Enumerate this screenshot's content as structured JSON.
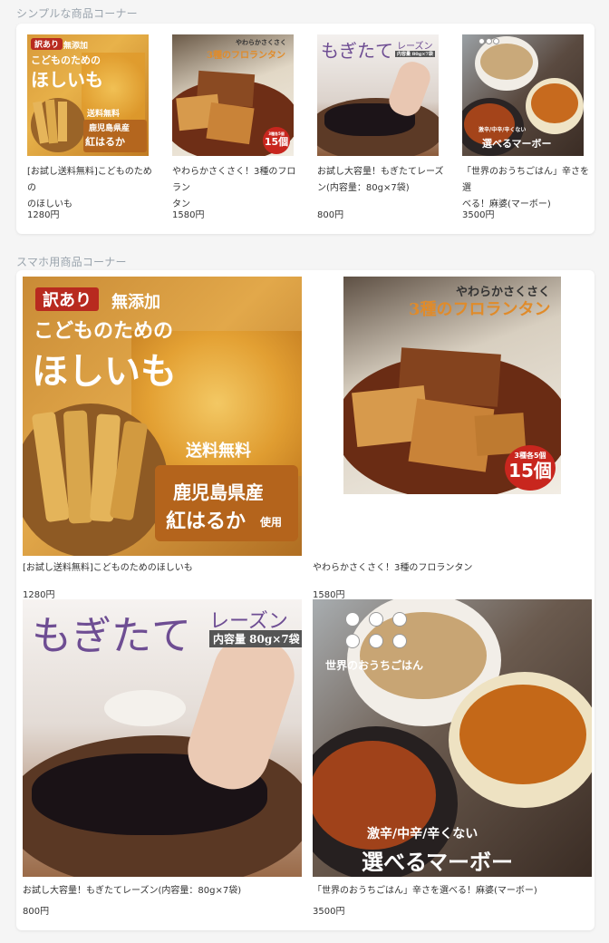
{
  "simple_section": {
    "title": "シンプルな商品コーナー",
    "items": [
      {
        "name": "[お試し送料無料]こどものための",
        "name2": "のほしいも",
        "price": "1280円"
      },
      {
        "name": "やわらかさくさく！3種のフロラン",
        "name2": "タン",
        "price": "1580円"
      },
      {
        "name": "お試し大容量！もぎたてレーズ",
        "name2": "ン(内容量：80g×7袋)",
        "price": "800円"
      },
      {
        "name": "「世界のおうちごはん」辛さを選",
        "name2": "べる！麻婆(マーボー)",
        "price": "3500円"
      }
    ]
  },
  "mobile_section": {
    "title": "スマホ用商品コーナー",
    "items": [
      {
        "name": "[お試し送料無料]こどものためのほしいも",
        "price": "1280円"
      },
      {
        "name": "やわらかさくさく！3種のフロランタン",
        "price": "1580円"
      },
      {
        "name": "お試し大容量！もぎたてレーズン(内容量：80g×7袋)",
        "price": "800円"
      },
      {
        "name": "「世界のおうちごはん」辛さを選べる！麻婆(マーボー)",
        "price": "3500円"
      }
    ]
  },
  "images": {
    "hoshiimo": {
      "badge": "訳あり",
      "line1": "無添加",
      "line2": "こどものための",
      "line3": "ほしいも",
      "line4": "送料無料",
      "line5": "鹿児島県産",
      "line6": "紅はるか",
      "line6b": "使用"
    },
    "florentin": {
      "line1": "やわらかさくさく",
      "line2": "3種のフロランタン",
      "badge_small": "3種各5個",
      "badge_big": "15個"
    },
    "raisin": {
      "line1": "もぎたて",
      "line2": "レーズン",
      "line3": "内容量 80g×7袋"
    },
    "mabo": {
      "line1": "世界のおうちごはん",
      "line2": "激辛/中辛/辛くない",
      "line3": "選べるマーボー"
    }
  },
  "colors": {
    "section_title": "#9aa4ad",
    "card_bg": "#ffffff",
    "page_bg": "#f5f5f5",
    "badge_red": "#b82a1f"
  }
}
